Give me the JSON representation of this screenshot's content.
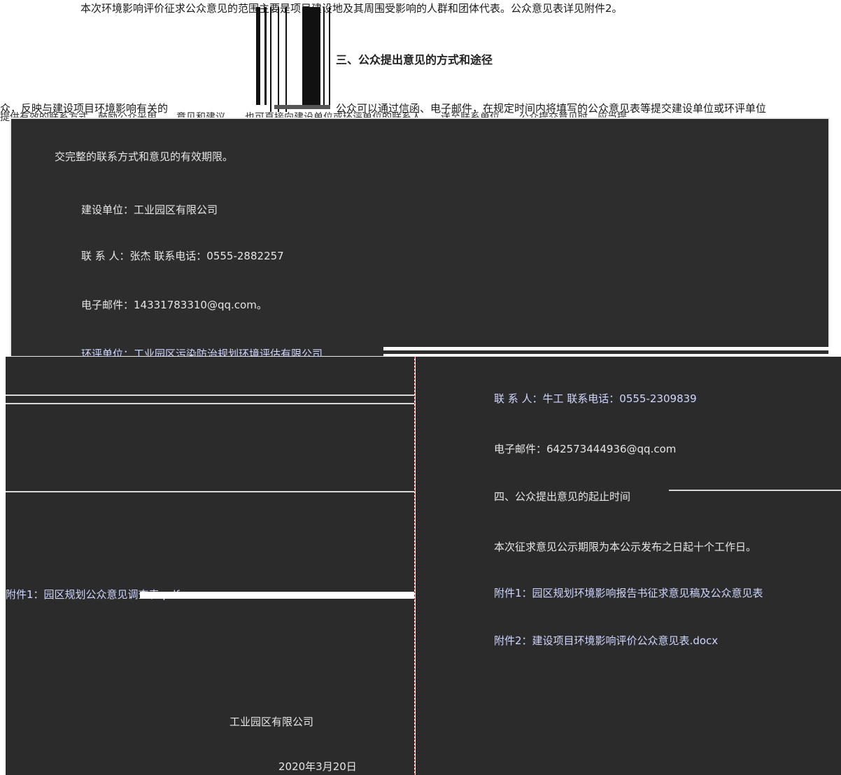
{
  "top": {
    "intro_line": "本次环境影响评价征求公众意见的范围主要是项目建设地及其周围受影响的人群和团体代表。公众意见表详见附件2。",
    "section_heading": "三、公众提出意见的方式和途径",
    "left_partial": "众，反映与建设项目环境影响有关的",
    "right_partial": "公众可以通过信函、电子邮件，在规定时间内将填写的公众意见表等提交建设单位或环评单位",
    "garbled_strip": "提供有效的联系方式，鼓励公众采用……意见和建议……也可直接向建设单位或环评单位的联系人……送至联系单位……公众提交意见时，应当提"
  },
  "upper_panel": {
    "line1": "交完整的联系方式和意见的有效期限。",
    "line2": "建设单位：工业园区有限公司",
    "line3": "联 系 人：张杰   联系电话：0555-2882257",
    "line4": "电子邮件：14331783310@qq.com。",
    "line5": "环评单位：工业园区污染防治规划环境评估有限公司"
  },
  "lower_left": {
    "file_link": "附件1：园区规划公众意见调查表.pdf",
    "company_sign": "工业园区有限公司",
    "date": "2020年3月20日"
  },
  "lower_right": {
    "contact": "联 系 人：牛工   联系电话：0555-2309839",
    "email": "电子邮件：642573444936@qq.com",
    "section4": "四、公众提出意见的起止时间",
    "period": "本次征求意见公示期限为本公示发布之日起十个工作日。",
    "attachment1": "附件1：园区规划环境影响报告书征求意见稿及公众意见表",
    "attachment2": "附件2：建设项目环境影响评价公众意见表.docx"
  },
  "colors": {
    "panel_dark": "#2b2b2b",
    "divider_red": "#b2312a",
    "text_light": "#e6e6e6",
    "text_blue": "#cfd6ff"
  }
}
